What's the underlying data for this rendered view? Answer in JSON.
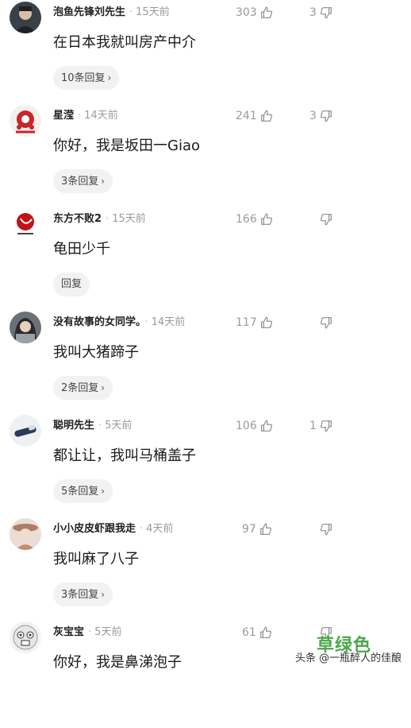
{
  "comments": [
    {
      "name": "泡鱼先锋刘先生",
      "time": "15天前",
      "text": "在日本我就叫房产中介",
      "reply": "10条回复",
      "likes": "303",
      "dislikes": "3",
      "avatar": "avatar-man-dark"
    },
    {
      "name": "星滢",
      "time": "14天前",
      "text": "你好，我是坂田一Giao",
      "reply": "3条回复",
      "likes": "241",
      "dislikes": "3",
      "avatar": "avatar-red-pattern"
    },
    {
      "name": "东方不败2",
      "time": "15天前",
      "text": "龟田少千",
      "reply": "回复",
      "likes": "166",
      "dislikes": "",
      "avatar": "avatar-red-sun"
    },
    {
      "name": "没有故事的女同学。",
      "time": "14天前",
      "text": "我叫大猪蹄子",
      "reply": "2条回复",
      "likes": "117",
      "dislikes": "",
      "avatar": "avatar-girl"
    },
    {
      "name": "聪明先生",
      "time": "5天前",
      "text": "都让让，我叫马桶盖子",
      "reply": "5条回复",
      "likes": "106",
      "dislikes": "1",
      "avatar": "avatar-bottle"
    },
    {
      "name": "小小皮皮虾跟我走",
      "time": "4天前",
      "text": "我叫麻了八子",
      "reply": "3条回复",
      "likes": "97",
      "dislikes": "",
      "avatar": "avatar-girl-hat"
    },
    {
      "name": "灰宝宝",
      "time": "5天前",
      "text": "你好，我是鼻涕泡子",
      "reply": "",
      "likes": "61",
      "dislikes": "",
      "avatar": "avatar-cartoon"
    }
  ],
  "watermark": {
    "green_text": "草绿色",
    "line": "头条 @一瓶醉人的佳酿"
  },
  "icons": {
    "like": "thumb-up-icon",
    "dislike": "thumb-down-icon",
    "chevron": "chevron-right-icon"
  },
  "colors": {
    "muted": "#9a9a9a",
    "reply_bg": "#f2f2f2",
    "watermark_green": "#4aa84a"
  }
}
